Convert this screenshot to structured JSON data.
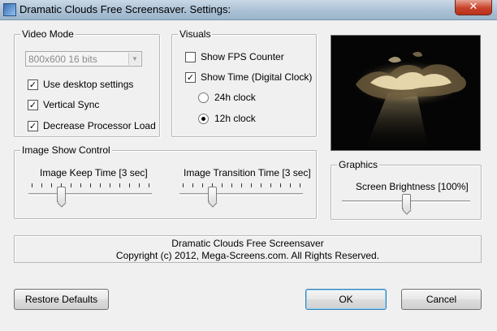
{
  "window": {
    "title": "Dramatic Clouds Free Screensaver. Settings:",
    "close_label": "✕"
  },
  "video_mode": {
    "group_label": "Video Mode",
    "resolution_value": "800x600 16 bits",
    "use_desktop_settings": {
      "label": "Use desktop settings",
      "checked": true
    },
    "vertical_sync": {
      "label": "Vertical Sync",
      "checked": true
    },
    "decrease_processor_load": {
      "label": "Decrease Processor Load",
      "checked": true
    }
  },
  "visuals": {
    "group_label": "Visuals",
    "show_fps_counter": {
      "label": "Show FPS Counter",
      "checked": false
    },
    "show_time": {
      "label": "Show Time (Digital Clock)",
      "checked": true
    },
    "clock_24h": {
      "label": "24h clock",
      "selected": false
    },
    "clock_12h": {
      "label": "12h clock",
      "selected": true
    }
  },
  "image_show_control": {
    "group_label": "Image Show Control",
    "keep_time": {
      "label": "Image Keep Time [3 sec]",
      "value": 3,
      "ticks": 13,
      "position_fraction": 0.25
    },
    "transition_time": {
      "label": "Image Transition Time [3 sec]",
      "value": 3,
      "ticks": 13,
      "position_fraction": 0.25
    }
  },
  "graphics": {
    "group_label": "Graphics",
    "brightness": {
      "label": "Screen Brightness [100%]",
      "value_percent": 100,
      "position_fraction": 0.5
    }
  },
  "info": {
    "line1": "Dramatic Clouds Free Screensaver",
    "line2": "Copyright (c) 2012, Mega-Screens.com. All Rights Reserved."
  },
  "buttons": {
    "restore_defaults": "Restore Defaults",
    "ok": "OK",
    "cancel": "Cancel"
  },
  "colors": {
    "preview_sky": "#050505",
    "cloud_highlight": "#f2e2b6",
    "cloud_shadow": "#6b5a3c"
  }
}
